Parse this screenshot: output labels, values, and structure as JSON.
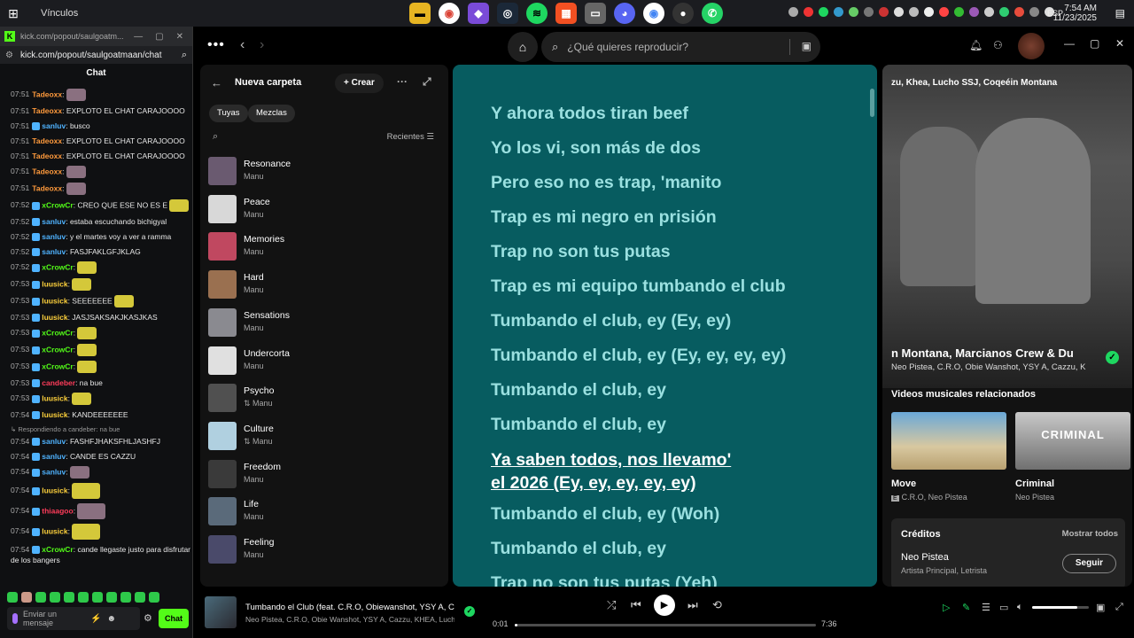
{
  "taskbar": {
    "window_title": "Vínculos",
    "language": "ESP",
    "time": "7:54 AM",
    "date": "11/23/2025"
  },
  "chat_window": {
    "url_tab": "kick.com/popout/saulgoatm...",
    "address": "kick.com/popout/saulgoatmaan/chat",
    "header": "Chat",
    "messages": [
      {
        "time": "07:51",
        "user": "Tadeoxx",
        "text": ":",
        "color": "#ff9a3c"
      },
      {
        "time": "07:51",
        "user": "Tadeoxx",
        "text": ": EXPLOTO EL CHAT CARAJOOOO",
        "color": "#ff9a3c"
      },
      {
        "time": "07:51",
        "user": "sanluv",
        "text": ": busco",
        "color": "#4fb3ff"
      },
      {
        "time": "07:51",
        "user": "Tadeoxx",
        "text": ": EXPLOTO EL CHAT CARAJOOOO",
        "color": "#ff9a3c"
      },
      {
        "time": "07:51",
        "user": "Tadeoxx",
        "text": ": EXPLOTO EL CHAT CARAJOOOO",
        "color": "#ff9a3c"
      },
      {
        "time": "07:51",
        "user": "Tadeoxx",
        "text": ":",
        "color": "#ff9a3c"
      },
      {
        "time": "07:51",
        "user": "Tadeoxx",
        "text": ":",
        "color": "#ff9a3c"
      },
      {
        "time": "07:52",
        "user": "xCrowCr",
        "text": ": CREO QUE ESE NO ES E",
        "color": "#53fc18"
      },
      {
        "time": "07:52",
        "user": "sanluv",
        "text": ": estaba escuchando bichigyal",
        "color": "#4fb3ff"
      },
      {
        "time": "07:52",
        "user": "sanluv",
        "text": ": y el martes voy a ver a ramma",
        "color": "#4fb3ff"
      },
      {
        "time": "07:52",
        "user": "sanluv",
        "text": ": FASJFAKLGFJKLAG",
        "color": "#4fb3ff"
      },
      {
        "time": "07:52",
        "user": "xCrowCr",
        "text": ":",
        "color": "#53fc18"
      },
      {
        "time": "07:53",
        "user": "luusick",
        "text": ":",
        "color": "#ffd23c"
      },
      {
        "time": "07:53",
        "user": "luusick",
        "text": ": SEEEEEEE",
        "color": "#ffd23c"
      },
      {
        "time": "07:53",
        "user": "luusick",
        "text": ": JASJSAKSAKJKASJKAS",
        "color": "#ffd23c"
      },
      {
        "time": "07:53",
        "user": "xCrowCr",
        "text": ":",
        "color": "#53fc18"
      },
      {
        "time": "07:53",
        "user": "xCrowCr",
        "text": ":",
        "color": "#53fc18"
      },
      {
        "time": "07:53",
        "user": "xCrowCr",
        "text": ":",
        "color": "#53fc18"
      },
      {
        "time": "07:53",
        "user": "candeber",
        "text": ": na bue",
        "color": "#ff3c5a"
      },
      {
        "time": "07:53",
        "user": "luusick",
        "text": ":",
        "color": "#ffd23c"
      },
      {
        "time": "07:54",
        "user": "luusick",
        "text": ": KANDEEEEEEE",
        "color": "#ffd23c"
      },
      {
        "time": "07:54",
        "user": "sanluv",
        "text": ": FASHFJHAKSFHLJASHFJ",
        "color": "#4fb3ff",
        "reply": "Respondiendo a candeber: na bue"
      },
      {
        "time": "07:54",
        "user": "sanluv",
        "text": ": CANDE ES CAZZU",
        "color": "#4fb3ff"
      },
      {
        "time": "07:54",
        "user": "sanluv",
        "text": ":",
        "color": "#4fb3ff"
      },
      {
        "time": "07:54",
        "user": "luusick",
        "text": ":",
        "color": "#ffd23c"
      },
      {
        "time": "07:54",
        "user": "thiaagoo",
        "text": ":",
        "color": "#ff3c5a"
      },
      {
        "time": "07:54",
        "user": "luusick",
        "text": ":",
        "color": "#ffd23c"
      },
      {
        "time": "07:54",
        "user": "xCrowCr",
        "text": ": cande llegaste justo para disfrutar de los bangers",
        "color": "#53fc18"
      }
    ],
    "input_placeholder": "Enviar un mensaje",
    "send_label": "Chat"
  },
  "spotify": {
    "search_placeholder": "¿Qué quieres reproducir?",
    "library": {
      "folder_title": "Nueva carpeta",
      "create_label": "Crear",
      "chips": [
        "Tuyas",
        "Mezclas"
      ],
      "sort_label": "Recientes",
      "playlists": [
        {
          "name": "Resonance",
          "owner": "Manu",
          "color": "#6a5a70"
        },
        {
          "name": "Peace",
          "owner": "Manu",
          "color": "#d8d8d8"
        },
        {
          "name": "Memories",
          "owner": "Manu",
          "color": "#c04860"
        },
        {
          "name": "Hard",
          "owner": "Manu",
          "color": "#9a7050"
        },
        {
          "name": "Sensations",
          "owner": "Manu",
          "color": "#8a8a90"
        },
        {
          "name": "Undercorta",
          "owner": "Manu",
          "color": "#e0e0e0"
        },
        {
          "name": "Psycho",
          "owner": "⇅ Manu",
          "color": "#505050"
        },
        {
          "name": "Culture",
          "owner": "⇅ Manu",
          "color": "#b0d0e0"
        },
        {
          "name": "Freedom",
          "owner": "Manu",
          "color": "#3a3a3a"
        },
        {
          "name": "Life",
          "owner": "Manu",
          "color": "#5a6a7a"
        },
        {
          "name": "Feeling",
          "owner": "Manu",
          "color": "#4a4a6a"
        }
      ]
    },
    "lyrics": {
      "lines": [
        "Y ahora todos tiran beef",
        "Yo los vi, son más de dos",
        "Pero eso no es trap, 'manito",
        "Trap es mi negro en prisión",
        "Trap no son tus putas",
        "Trap es mi equipo tumbando el club",
        "Tumbando el club, ey (Ey, ey)",
        "Tumbando el club, ey (Ey, ey, ey, ey)",
        "Tumbando el club, ey",
        "Tumbando el club, ey"
      ],
      "current_line_1": "Ya saben todos, nos llevamo'",
      "current_line_2": "el 2026 (Ey, ey, ey, ey, ey)",
      "after_lines": [
        "Tumbando el club, ey (Woh)",
        "Tumbando el club, ey",
        "Trap no son tus putas (Yeh)"
      ]
    },
    "now_playing": {
      "artists_header": "zu, Khea, Lucho SSJ, Coqeéin Montana",
      "title": "n Montana, Marcianos Crew & Du",
      "subtitle": "Neo Pistea, C.R.O, Obie Wanshot, YSY A, Cazzu, K",
      "related_header": "Videos musicales relacionados",
      "videos": [
        {
          "title": "Move",
          "artists": "C.R.O, Neo Pistea",
          "explicit": "E"
        },
        {
          "title": "Criminal",
          "artists": "Neo Pistea",
          "thumb_text": "CRIMINAL"
        }
      ],
      "credits": {
        "header": "Créditos",
        "show_all": "Mostrar todos",
        "artist": "Neo Pistea",
        "role": "Artista Principal, Letrista",
        "follow": "Seguir"
      }
    },
    "player": {
      "track": "Tumbando el Club (feat. C.R.O, Obiewanshot, YSY A, Cazz",
      "artists": "Neo Pistea, C.R.O, Obie Wanshot, YSY A, Cazzu, KHEA, Lucho SSJ,",
      "current_time": "0:01",
      "total_time": "7:36",
      "progress": 0.002,
      "volume": 0.8
    }
  }
}
